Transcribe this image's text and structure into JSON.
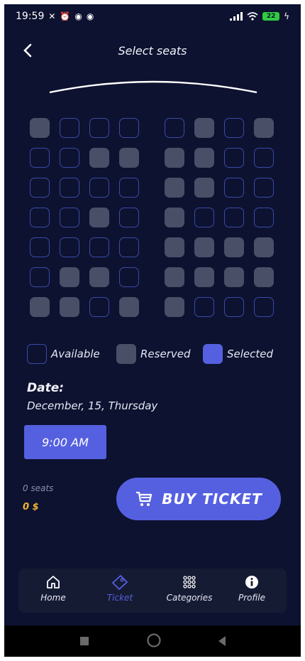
{
  "status_bar": {
    "time": "19:59",
    "notification_icons": [
      "bluetooth-off-icon",
      "alarm-icon",
      "app-icon",
      "app-icon"
    ],
    "battery": "22"
  },
  "header": {
    "back_icon": "chevron-left-icon",
    "title": "Select seats"
  },
  "seats": {
    "rows": [
      [
        "reserved",
        "available",
        "available",
        "available",
        "available",
        "reserved",
        "available",
        "reserved"
      ],
      [
        "available",
        "available",
        "reserved",
        "reserved",
        "reserved",
        "reserved",
        "available",
        "available"
      ],
      [
        "available",
        "available",
        "available",
        "available",
        "reserved",
        "reserved",
        "available",
        "available"
      ],
      [
        "available",
        "available",
        "reserved",
        "available",
        "reserved",
        "available",
        "available",
        "available"
      ],
      [
        "available",
        "available",
        "available",
        "available",
        "reserved",
        "reserved",
        "reserved",
        "reserved"
      ],
      [
        "available",
        "reserved",
        "reserved",
        "available",
        "reserved",
        "reserved",
        "reserved",
        "reserved"
      ],
      [
        "reserved",
        "reserved",
        "available",
        "reserved",
        "reserved",
        "available",
        "available",
        "available"
      ]
    ]
  },
  "legend": {
    "available": "Available",
    "reserved": "Reserved",
    "selected": "Selected"
  },
  "date": {
    "label": "Date:",
    "value": "December, 15, Thursday"
  },
  "time_slot": {
    "label": "9:00 AM"
  },
  "summary": {
    "seats": "0 seats",
    "price": "0 $"
  },
  "buy_button": {
    "label": "BUY TICKET",
    "icon": "cart-icon"
  },
  "bottom_nav": {
    "items": [
      {
        "label": "Home",
        "icon": "home-icon"
      },
      {
        "label": "Ticket",
        "icon": "ticket-icon"
      },
      {
        "label": "Categories",
        "icon": "grid-dots-icon"
      },
      {
        "label": "Profile",
        "icon": "info-icon"
      }
    ],
    "active": "Ticket"
  },
  "colors": {
    "background": "#0d1230",
    "accent": "#5560e0",
    "reserved": "#4a4f68",
    "available_border": "#3a4aa8",
    "price": "#f2b632"
  }
}
